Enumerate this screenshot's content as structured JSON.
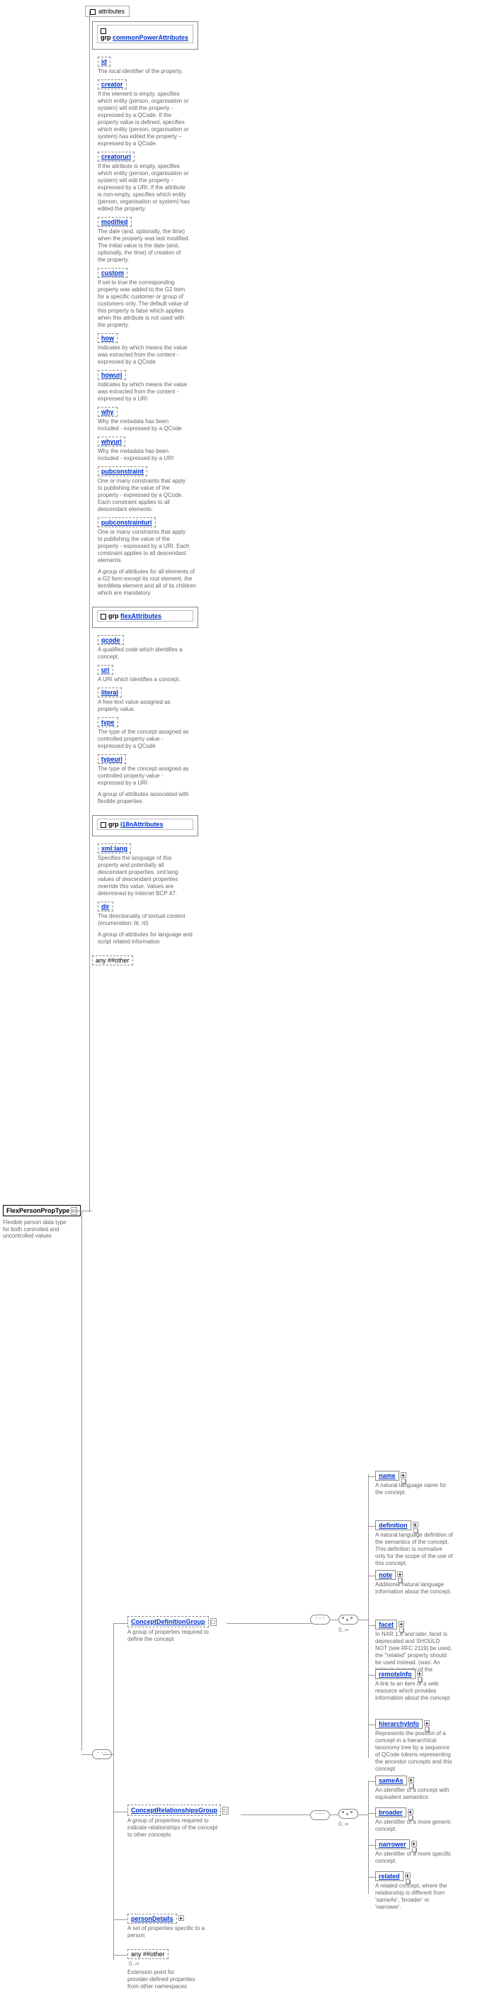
{
  "root": {
    "name": "FlexPersonPropType",
    "desc": "Flexible person data type for both controlled and uncontrolled values"
  },
  "attributes_label": "attributes",
  "grp_prefix": "grp",
  "commonPower": {
    "name": "commonPowerAttributes",
    "items": [
      {
        "label": "id",
        "desc": "The local identifier of the property."
      },
      {
        "label": "creator",
        "desc": "If the element is empty, specifies which entity (person, organisation or system) will edit the property - expressed by a QCode. If the property value is defined, specifies which entity (person, organisation or system) has edited the property – expressed by a QCode."
      },
      {
        "label": "creatoruri",
        "desc": "If the attribute is empty, specifies which entity (person, organisation or system) will edit the property - expressed by a URI. If the attribute is non-empty, specifies which entity (person, organisation or system) has edited the property."
      },
      {
        "label": "modified",
        "desc": "The date (and, optionally, the time) when the property was last modified. The initial value is the date (and, optionally, the time) of creation of the property."
      },
      {
        "label": "custom",
        "desc": "If set to true the corresponding property was added to the G2 Item for a specific customer or group of customers only. The default value of this property is false which applies when this attribute is not used with the property."
      },
      {
        "label": "how",
        "desc": "Indicates by which means the value was extracted from the content - expressed by a QCode"
      },
      {
        "label": "howuri",
        "desc": "Indicates by which means the value was extracted from the content - expressed by a URI"
      },
      {
        "label": "why",
        "desc": "Why the metadata has been included - expressed by a QCode"
      },
      {
        "label": "whyuri",
        "desc": "Why the metadata has been included - expressed by a URI"
      },
      {
        "label": "pubconstraint",
        "desc": "One or many constraints that apply to publishing the value of the property - expressed by a QCode. Each constraint applies to all descendant elements."
      },
      {
        "label": "pubconstrainturi",
        "desc": "One or many constraints that apply to publishing the value of the property - expressed by a URI. Each constraint applies to all descendant elements."
      }
    ],
    "group_desc": "A group of attributes for all elements of a G2 Item except its root element, the itemMeta element and all of its children which are mandatory."
  },
  "flexAttributes": {
    "name": "flexAttributes",
    "items": [
      {
        "label": "qcode",
        "desc": "A qualified code which identifies a concept."
      },
      {
        "label": "uri",
        "desc": "A URI which identifies a concept."
      },
      {
        "label": "literal",
        "desc": "A free-text value assigned as property value."
      },
      {
        "label": "type",
        "desc": "The type of the concept assigned as controlled property value - expressed by a QCode"
      },
      {
        "label": "typeuri",
        "desc": "The type of the concept assigned as controlled property value - expressed by a URI"
      }
    ],
    "group_desc": "A group of attributes associated with flexible properties"
  },
  "i18nAttributes": {
    "name": "i18nAttributes",
    "items": [
      {
        "label": "xml:lang",
        "desc": "Specifies the language of this property and potentially all descendant properties. xml:lang values of descendant properties override this value. Values are determined by Internet BCP 47."
      },
      {
        "label": "dir",
        "desc": "The directionality of textual content (enumeration: ltr, rtl)"
      }
    ],
    "group_desc": "A group of attributes for language and script related information"
  },
  "any_other": "any ##other",
  "conceptDefinition": {
    "name": "ConceptDefinitionGroup",
    "desc": "A group of properties required to define the concept"
  },
  "conceptRelationships": {
    "name": "ConceptRelationshipsGroup",
    "desc": "A group of properties required to indicate relationships of the concept to other concepts"
  },
  "personDetails": {
    "name": "personDetails",
    "desc": "A set of properties specific to a person"
  },
  "extPoint": {
    "name": "any ##other",
    "desc": "Extension point for provider-defined properties from other namespaces",
    "occurs": "0..∞"
  },
  "occurs_inf": "0..∞",
  "cdg_elems": [
    {
      "label": "name",
      "desc": "A natural language name for the concept."
    },
    {
      "label": "definition",
      "desc": "A natural language definition of the semantics of the concept. This definition is normative only for the scope of the use of this concept."
    },
    {
      "label": "note",
      "desc": "Additional natural language information about the concept."
    },
    {
      "label": "facet",
      "desc": "In NAR 1.8 and later, facet is deprecated and SHOULD NOT (see RFC 2119) be used, the \"related\" property should be used instead. (was: An intrinsic property of the concept.)"
    },
    {
      "label": "remoteInfo",
      "desc": "A link to an item or a web resource which provides information about the concept"
    },
    {
      "label": "hierarchyInfo",
      "desc": "Represents the position of a concept in a hierarchical taxonomy tree by a sequence of QCode tokens representing the ancestor concepts and this concept"
    }
  ],
  "crg_elems": [
    {
      "label": "sameAs",
      "desc": "An identifier of a concept with equivalent semantics"
    },
    {
      "label": "broader",
      "desc": "An identifier of a more generic concept."
    },
    {
      "label": "narrower",
      "desc": "An identifier of a more specific concept."
    },
    {
      "label": "related",
      "desc": "A related concept, where the relationship is different from 'sameAs', 'broader' or 'narrower'."
    }
  ]
}
